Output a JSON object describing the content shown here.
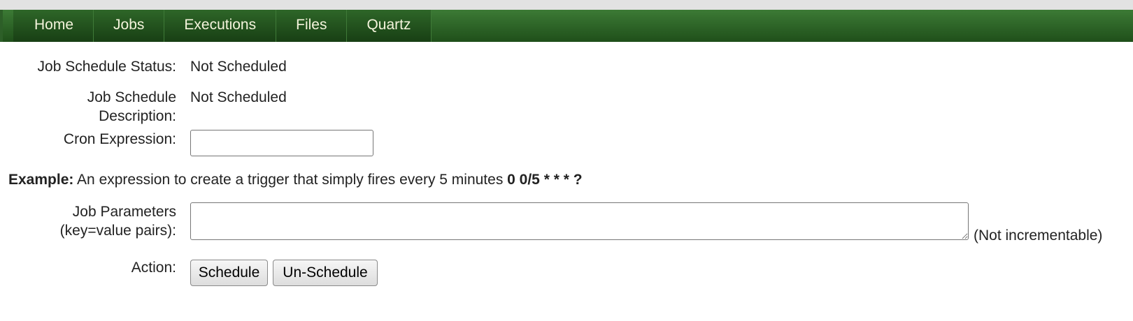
{
  "nav": {
    "items": [
      "Home",
      "Jobs",
      "Executions",
      "Files",
      "Quartz"
    ]
  },
  "form": {
    "status_label": "Job Schedule Status:",
    "status_value": "Not Scheduled",
    "description_label_line1": "Job Schedule",
    "description_label_line2": "Description:",
    "description_value": "Not Scheduled",
    "cron_label": "Cron Expression:",
    "cron_value": "",
    "example_bold": "Example:",
    "example_text": " An expression to create a trigger that simply fires every 5 minutes ",
    "example_expr": "0 0/5 * * * ?",
    "params_label_line1": "Job Parameters",
    "params_label_line2": "(key=value pairs):",
    "params_value": "",
    "params_note": "(Not incrementable)",
    "action_label": "Action:",
    "schedule_button": "Schedule",
    "unschedule_button": "Un-Schedule"
  },
  "colors": {
    "nav_bg": "#2e6628",
    "nav_text": "#f4f4dc"
  }
}
